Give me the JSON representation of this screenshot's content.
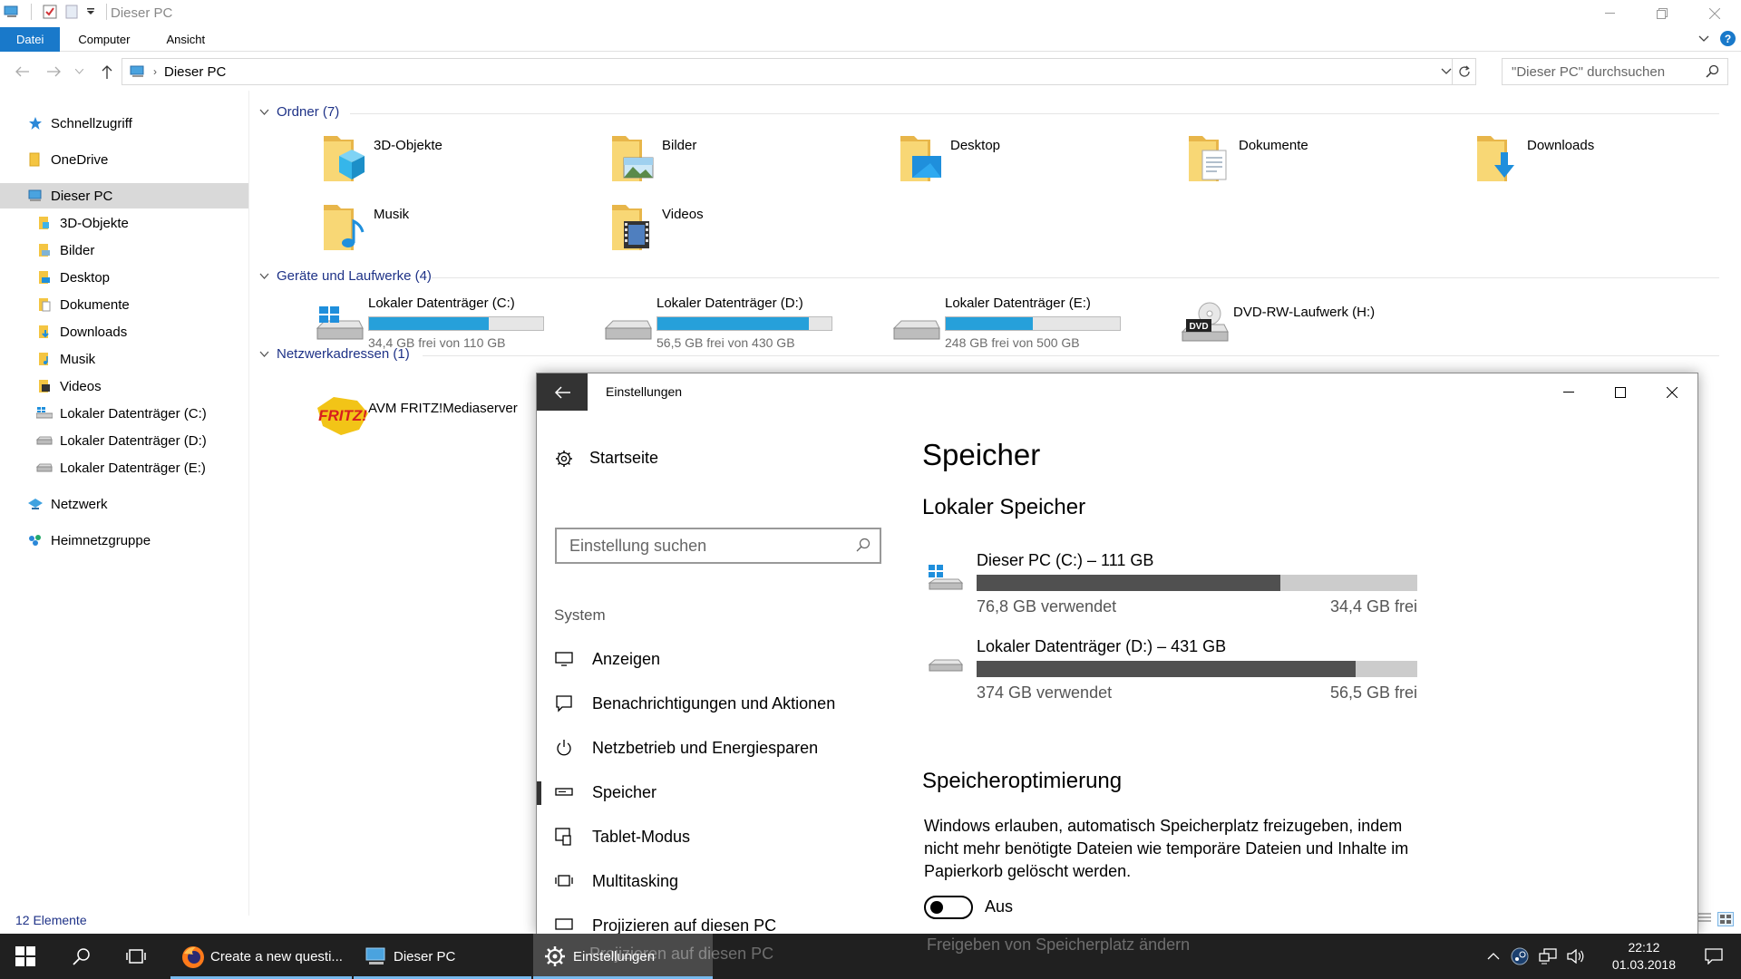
{
  "explorer": {
    "title": "Dieser PC",
    "ribbon_tabs": [
      "Datei",
      "Computer",
      "Ansicht"
    ],
    "help_label": "?",
    "address": "Dieser PC",
    "search_placeholder": "\"Dieser PC\" durchsuchen",
    "nav": [
      {
        "label": "Schnellzugriff",
        "icon": "star-icon"
      },
      {
        "label": "OneDrive",
        "icon": "onedrive-folder-icon"
      },
      {
        "label": "Dieser PC",
        "icon": "computer-icon"
      },
      {
        "label": "3D-Objekte",
        "icon": "folder-3d-icon"
      },
      {
        "label": "Bilder",
        "icon": "folder-pictures-icon"
      },
      {
        "label": "Desktop",
        "icon": "folder-desktop-icon"
      },
      {
        "label": "Dokumente",
        "icon": "folder-documents-icon"
      },
      {
        "label": "Downloads",
        "icon": "folder-downloads-icon"
      },
      {
        "label": "Musik",
        "icon": "folder-music-icon"
      },
      {
        "label": "Videos",
        "icon": "folder-videos-icon"
      },
      {
        "label": "Lokaler Datenträger (C:)",
        "icon": "windows-drive-icon"
      },
      {
        "label": "Lokaler Datenträger (D:)",
        "icon": "drive-icon"
      },
      {
        "label": "Lokaler Datenträger (E:)",
        "icon": "drive-icon"
      },
      {
        "label": "Netzwerk",
        "icon": "network-icon"
      },
      {
        "label": "Heimnetzgruppe",
        "icon": "homegroup-icon"
      }
    ],
    "groups": {
      "folders": "Ordner (7)",
      "drives": "Geräte und Laufwerke (4)",
      "network": "Netzwerkadressen (1)"
    },
    "folders": [
      "3D-Objekte",
      "Bilder",
      "Desktop",
      "Dokumente",
      "Downloads",
      "Musik",
      "Videos"
    ],
    "drives": [
      {
        "name": "Lokaler Datenträger (C:)",
        "free": "34,4 GB frei von 110 GB",
        "used_fraction": 0.69
      },
      {
        "name": "Lokaler Datenträger (D:)",
        "free": "56,5 GB frei von 430 GB",
        "used_fraction": 0.87
      },
      {
        "name": "Lokaler Datenträger (E:)",
        "free": "248 GB frei von 500 GB",
        "used_fraction": 0.5
      },
      {
        "name": "DVD-RW-Laufwerk (H:)",
        "dvd_badge": "DVD"
      }
    ],
    "network_locations": [
      {
        "name": "AVM FRITZ!Mediaserver",
        "logo_text": "FRITZ!"
      }
    ],
    "status": "12 Elemente"
  },
  "settings": {
    "title": "Einstellungen",
    "home": "Startseite",
    "search_placeholder": "Einstellung suchen",
    "category": "System",
    "nav_items": [
      {
        "label": "Anzeigen",
        "icon": "monitor-icon"
      },
      {
        "label": "Benachrichtigungen und Aktionen",
        "icon": "notification-icon"
      },
      {
        "label": "Netzbetrieb und Energiesparen",
        "icon": "power-icon"
      },
      {
        "label": "Speicher",
        "icon": "storage-icon",
        "active": true
      },
      {
        "label": "Tablet-Modus",
        "icon": "tablet-icon"
      },
      {
        "label": "Multitasking",
        "icon": "multitasking-icon"
      },
      {
        "label": "Projizieren auf diesen PC",
        "icon": "project-icon"
      }
    ],
    "heading": "Speicher",
    "local_storage": "Lokaler Speicher",
    "drives": [
      {
        "name": "Dieser PC (C:) – 111 GB",
        "used": "76,8 GB verwendet",
        "free": "34,4 GB frei",
        "used_fraction": 0.69
      },
      {
        "name": "Lokaler Datenträger (D:) – 431 GB",
        "used": "374 GB verwendet",
        "free": "56,5 GB frei",
        "used_fraction": 0.86
      }
    ],
    "optimization_heading": "Speicheroptimierung",
    "optimization_desc": "Windows erlauben, automatisch Speicherplatz freizugeben, indem nicht mehr benötigte Dateien wie temporäre Dateien und Inhalte im Papierkorb gelöscht werden.",
    "toggle_label": "Aus",
    "toggle_on": false,
    "free_space_link": "Freigeben von Speicherplatz ändern"
  },
  "taskbar": {
    "apps": [
      {
        "label": "Create a new questi...",
        "icon": "firefox-icon"
      },
      {
        "label": "Dieser PC",
        "icon": "explorer-icon"
      },
      {
        "label": "Einstellungen",
        "icon": "gear-icon"
      }
    ],
    "time": "22:12",
    "date": "01.03.2018"
  },
  "colors": {
    "accent": "#1979ca",
    "drive_bar": "#26a0da",
    "taskbar": "#202020",
    "settings_bar": "#505050"
  }
}
